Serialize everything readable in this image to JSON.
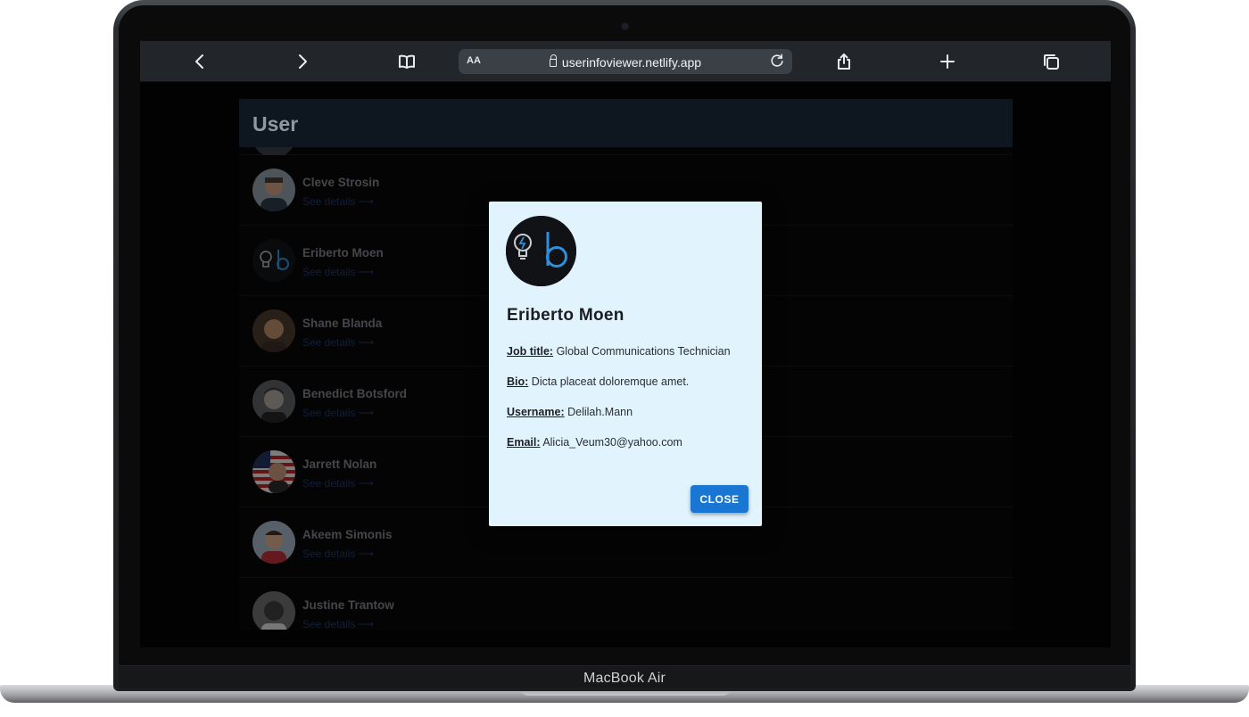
{
  "device": {
    "brand_label": "MacBook Air"
  },
  "browser": {
    "reader_label": "AA",
    "url": "userinfoviewer.netlify.app",
    "icons": [
      "chevron-left-icon",
      "chevron-right-icon",
      "book-icon",
      "lock-icon",
      "reload-icon",
      "share-icon",
      "plus-icon",
      "tabs-icon"
    ]
  },
  "app": {
    "title": "User",
    "see_details_label": "See details ⟶",
    "users": [
      {
        "name": "Cleve Strosin"
      },
      {
        "name": "Eriberto Moen"
      },
      {
        "name": "Shane Blanda"
      },
      {
        "name": "Benedict Botsford"
      },
      {
        "name": "Jarrett Nolan"
      },
      {
        "name": "Akeem Simonis"
      },
      {
        "name": "Justine Trantow"
      }
    ]
  },
  "modal": {
    "name": "Eriberto Moen",
    "fields": [
      {
        "label": "Job title:",
        "value": "Global Communications Technician"
      },
      {
        "label": "Bio:",
        "value": "Dicta placeat doloremque amet."
      },
      {
        "label": "Username:",
        "value": "Delilah.Mann"
      },
      {
        "label": "Email:",
        "value": "Alicia_Veum30@yahoo.com"
      }
    ],
    "close_label": "CLOSE"
  },
  "colors": {
    "accent": "#1976d2",
    "modal_bg": "#e1f3fd",
    "link": "#213a69"
  }
}
